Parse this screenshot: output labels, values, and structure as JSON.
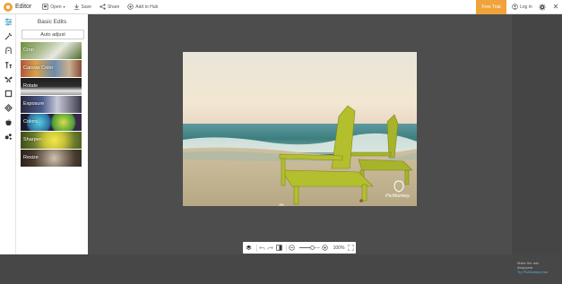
{
  "app": {
    "title": "Editor"
  },
  "toolbar": {
    "open_label": "Open",
    "save_label": "Save",
    "share_label": "Share",
    "hub_label": "Add to Hub",
    "free_trial_label": "Free Trial",
    "login_label": "Log in"
  },
  "tools": [
    "sliders-icon",
    "magic-wand-icon",
    "layers-icon",
    "text-icon",
    "butterfly-icon",
    "frame-icon",
    "texture-icon",
    "apple-icon",
    "touch-up-icon"
  ],
  "panel": {
    "title": "Basic Edits",
    "auto_adjust_label": "Auto adjust",
    "tiles": [
      "Crop",
      "Canvas Color",
      "Rotate",
      "Exposure",
      "Colors",
      "Sharpen",
      "Resize"
    ]
  },
  "watermark": {
    "text": "PicMonkey"
  },
  "zoom": {
    "value_label": "100%",
    "level": 0.55
  },
  "ad": {
    "line1": "Make the ads",
    "line2": "disappear",
    "link": "Try PicMonkey free"
  },
  "colors": {
    "accent": "#f0a23b",
    "active_tool": "#3aa0c8"
  }
}
